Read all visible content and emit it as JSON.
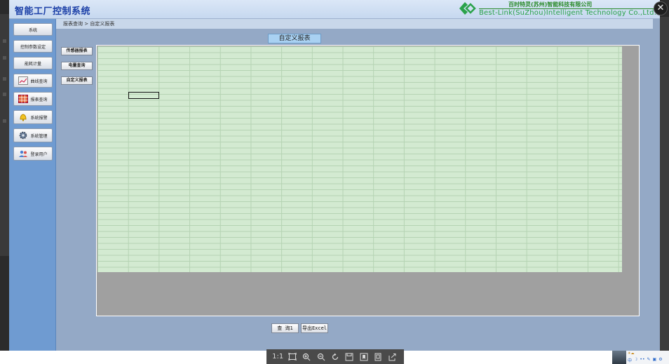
{
  "app": {
    "title": "智能工厂控制系统",
    "company_cn": "百时特灵(苏州)智能科技有限公司",
    "company_en": "Best-Link(SuZhou)Intelligent Technology Co.,Ltd."
  },
  "sidebar": {
    "items": [
      {
        "label": "系统"
      },
      {
        "label": "控制参数设定"
      },
      {
        "label": "能耗计量"
      },
      {
        "label": "曲线查询",
        "icon": "line-chart-icon"
      },
      {
        "label": "报表查询",
        "icon": "table-grid-icon"
      },
      {
        "label": "系统报警",
        "icon": "bell-icon"
      },
      {
        "label": "系统管理",
        "icon": "gear-icon"
      },
      {
        "label": "登录用户",
        "icon": "users-icon"
      }
    ]
  },
  "breadcrumb": "报表查询 > 自定义报表",
  "report": {
    "title": "自定义报表",
    "side_buttons": [
      "传感器报表",
      "电量查询",
      "自定义报表"
    ]
  },
  "actions": {
    "query": "查 询1",
    "export": "导出Excel"
  },
  "viewer_toolbar": {
    "items": [
      {
        "label": "1:1",
        "icon": "actual-size-icon"
      },
      {
        "icon": "fit-window-icon"
      },
      {
        "icon": "zoom-in-icon"
      },
      {
        "icon": "zoom-out-icon"
      },
      {
        "icon": "rotate-icon"
      },
      {
        "icon": "save-icon"
      },
      {
        "icon": "bookmark-icon"
      },
      {
        "icon": "copy-icon"
      },
      {
        "icon": "share-icon"
      }
    ]
  },
  "colors": {
    "accent_title": "#1b3fa7",
    "sidebar_bg": "#6f9bd1",
    "sheet_grid": "#d3ead1",
    "company_green": "#2a8a2a"
  }
}
